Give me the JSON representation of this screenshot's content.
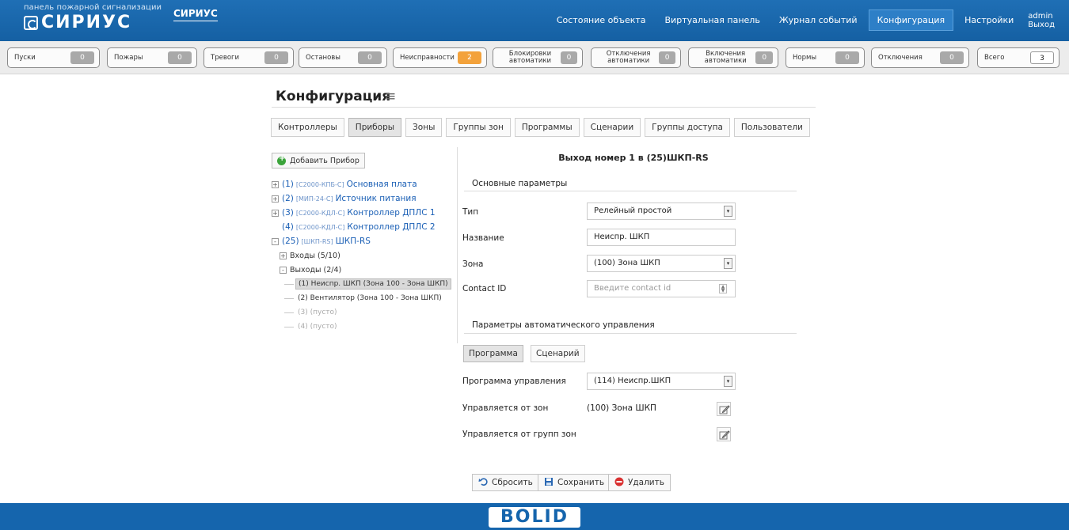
{
  "header": {
    "brand_sub": "панель пожарной сигнализации",
    "brand_logo": "СИРИУС",
    "brand_name": "СИРИУС",
    "nav": [
      "Состояние объекта",
      "Виртуальная панель",
      "Журнал событий",
      "Конфигурация",
      "Настройки"
    ],
    "active_nav": "Конфигурация",
    "user": "admin",
    "logout": "Выход"
  },
  "counters": [
    {
      "label": "Пуски",
      "value": "0"
    },
    {
      "label": "Пожары",
      "value": "0"
    },
    {
      "label": "Тревоги",
      "value": "0"
    },
    {
      "label": "Остановы",
      "value": "0"
    },
    {
      "label": "Неисправности",
      "value": "2",
      "status": "warn"
    },
    {
      "label": "Блокировки автоматики",
      "value": "0"
    },
    {
      "label": "Отключения автоматики",
      "value": "0"
    },
    {
      "label": "Включения автоматики",
      "value": "0"
    },
    {
      "label": "Нормы",
      "value": "0"
    },
    {
      "label": "Отключения",
      "value": "0"
    },
    {
      "label": "Всего",
      "value": "3",
      "status": "total"
    }
  ],
  "page": {
    "title": "Конфигурация",
    "tabs": [
      "Контроллеры",
      "Приборы",
      "Зоны",
      "Группы зон",
      "Программы",
      "Сценарии",
      "Группы доступа",
      "Пользователи"
    ],
    "active_tab": "Приборы"
  },
  "tree": {
    "add_button": "Добавить Прибор",
    "devices": [
      {
        "num": "(1)",
        "tag": "[С2000-КПБ-С]",
        "name": "Основная плата",
        "toggle": "+"
      },
      {
        "num": "(2)",
        "tag": "[МИП-24-С]",
        "name": "Источник питания",
        "toggle": "+"
      },
      {
        "num": "(3)",
        "tag": "[С2000-КДЛ-С]",
        "name": "Контроллер ДПЛС 1",
        "toggle": "+"
      },
      {
        "num": "(4)",
        "tag": "[С2000-КДЛ-С]",
        "name": "Контроллер ДПЛС 2",
        "toggle": ""
      },
      {
        "num": "(25)",
        "tag": "[ШКП-RS]",
        "name": "ШКП-RS",
        "toggle": "-"
      }
    ],
    "inputs": "Входы (5/10)",
    "outputs": "Выходы (2/4)",
    "output_items": [
      {
        "label": "(1) Неиспр. ШКП (Зона 100 - Зона ШКП)",
        "selected": true
      },
      {
        "label": "(2) Вентилятор (Зона 100 - Зона ШКП)",
        "selected": false
      },
      {
        "label": "(3) (пусто)",
        "selected": false,
        "empty": true
      },
      {
        "label": "(4) (пусто)",
        "selected": false,
        "empty": true
      }
    ]
  },
  "form": {
    "title": "Выход номер 1 в (25)ШКП-RS",
    "section_basic": "Основные параметры",
    "type_label": "Тип",
    "type_value": "Релейный простой",
    "name_label": "Название",
    "name_value": "Неиспр. ШКП",
    "zone_label": "Зона",
    "zone_value": "(100) Зона ШКП",
    "cid_label": "Contact ID",
    "cid_placeholder": "Введите contact id",
    "section_auto": "Параметры автоматического управления",
    "subtabs": [
      "Программа",
      "Сценарий"
    ],
    "active_subtab": "Программа",
    "program_label": "Программа управления",
    "program_value": "(114) Неиспр.ШКП",
    "zones_label": "Управляется от зон",
    "zones_value": "(100) Зона ШКП",
    "groups_label": "Управляется от групп зон",
    "groups_value": ""
  },
  "actions": {
    "reset": "Сбросить",
    "save": "Сохранить",
    "delete": "Удалить"
  },
  "footer": {
    "logo": "BOLID"
  },
  "colors": {
    "header_blue": "#1f6fb5",
    "link_blue": "#1a5fb5",
    "warn_orange": "#f3a23b",
    "add_green": "#3ba43b",
    "delete_red": "#d93030"
  }
}
